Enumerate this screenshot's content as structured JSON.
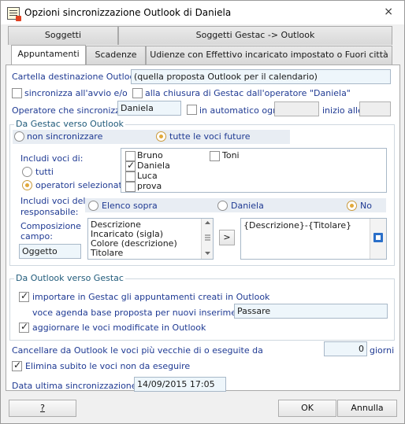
{
  "window": {
    "title": "Opzioni sincronizzazione Outlook di Daniela",
    "close_glyph": "×"
  },
  "tabs_row1": [
    "Soggetti",
    "Soggetti Gestac -> Outlook"
  ],
  "tabs_row2": [
    "Appuntamenti",
    "Scadenze",
    "Udienze con Effettivo incaricato impostato o Fuori città"
  ],
  "folder": {
    "label": "Cartella destinazione Outlook:",
    "value": "(quella proposta Outlook per il calendario)"
  },
  "sync_start_label": "sincronizza all'avvio e/o",
  "sync_close_label": "alla chiusura di Gestac dall'operatore \"Daniela\"",
  "operator": {
    "label": "Operatore che sincronizza:",
    "value": "Daniela",
    "auto_label": "in automatico ogni:",
    "start_label": "inizio alle:"
  },
  "gestac_group": {
    "title": "Da Gestac verso Outlook",
    "no_sync": "non sincronizzare",
    "all_future": "tutte le voci future",
    "include_label": "Includi voci di:",
    "all_label": "tutti",
    "selected_label": "operatori selezionati",
    "operators": [
      {
        "name": "Bruno",
        "checked": false
      },
      {
        "name": "Toni",
        "checked": false
      },
      {
        "name": "Daniela",
        "checked": true
      },
      {
        "name": "Luca",
        "checked": false
      },
      {
        "name": "prova",
        "checked": false
      }
    ],
    "resp_label_1": "Includi voci del",
    "resp_label_2": "responsabile:",
    "resp_options": [
      "Elenco sopra",
      "Daniela",
      "No"
    ],
    "comp_label_1": "Composizione",
    "comp_label_2": "campo:",
    "comp_value": "Oggetto",
    "fields": [
      "Descrizione",
      "Incaricato (sigla)",
      "Colore (descrizione)",
      "Titolare"
    ],
    "add_glyph": ">",
    "composition": "{Descrizione}-{Titolare}"
  },
  "outlook_group": {
    "title": "Da Outlook verso Gestac",
    "import_label": "importare in Gestac gli appuntamenti creati in Outlook",
    "agenda_label": "voce agenda base proposta per nuovi inserimenti:",
    "agenda_value": "Passare",
    "update_label": "aggiornare le voci modificate in Outlook"
  },
  "cleanup": {
    "label": "Cancellare da Outlook le voci più vecchie di o eseguite da",
    "value": "0",
    "unit": "giorni"
  },
  "delete_label": "Elimina subito le voci non da eseguire",
  "last_sync": {
    "label": "Data ultima sincronizzazione:",
    "value": "14/09/2015 17:05"
  },
  "buttons": {
    "help": "?",
    "ok": "OK",
    "cancel": "Annulla"
  }
}
